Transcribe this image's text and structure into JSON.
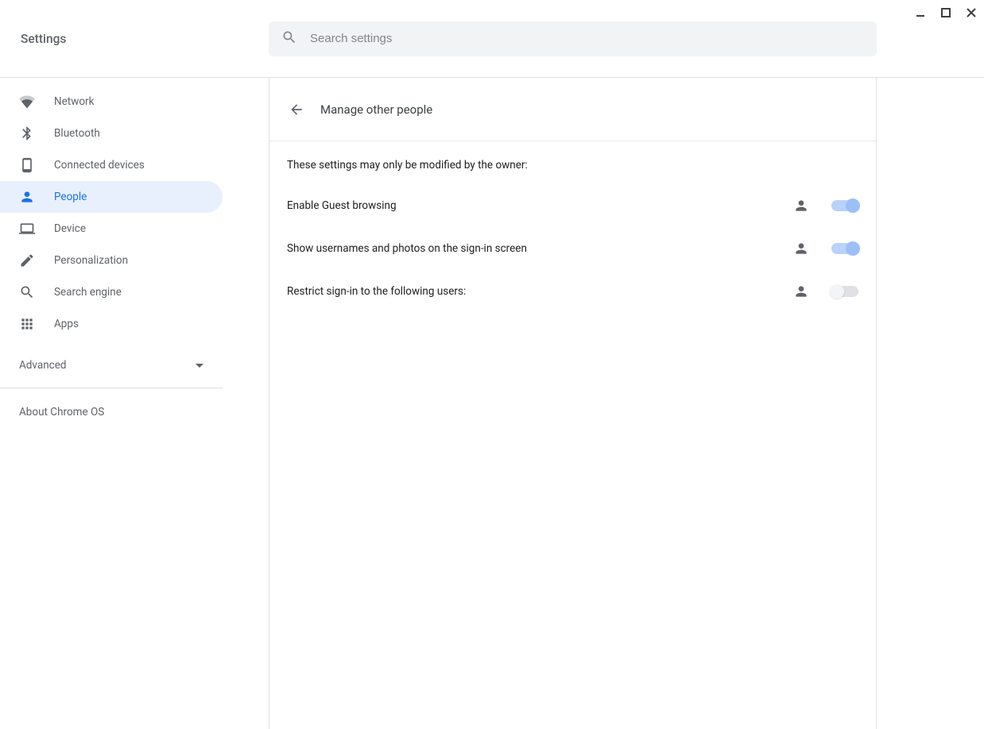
{
  "window": {
    "os": "Chrome OS",
    "app": "Settings"
  },
  "header": {
    "title": "Settings",
    "search_placeholder": "Search settings"
  },
  "sidebar": {
    "items": [
      {
        "id": "network",
        "label": "Network",
        "icon": "wifi-icon",
        "active": false
      },
      {
        "id": "bluetooth",
        "label": "Bluetooth",
        "icon": "bluetooth-icon",
        "active": false
      },
      {
        "id": "connected",
        "label": "Connected devices",
        "icon": "phone-icon",
        "active": false
      },
      {
        "id": "people",
        "label": "People",
        "icon": "person-icon",
        "active": true
      },
      {
        "id": "device",
        "label": "Device",
        "icon": "laptop-icon",
        "active": false
      },
      {
        "id": "personalization",
        "label": "Personalization",
        "icon": "pen-icon",
        "active": false
      },
      {
        "id": "search_engine",
        "label": "Search engine",
        "icon": "search-icon",
        "active": false
      },
      {
        "id": "apps",
        "label": "Apps",
        "icon": "apps-grid-icon",
        "active": false
      }
    ],
    "advanced_label": "Advanced",
    "about_label": "About Chrome OS"
  },
  "main": {
    "subpage_title": "Manage other people",
    "owner_notice": "These settings may only be modified by the owner:",
    "settings": [
      {
        "id": "guest_browsing",
        "label": "Enable Guest browsing",
        "managed_by_owner": true,
        "toggle": {
          "on": true,
          "disabled": true
        }
      },
      {
        "id": "show_usernames",
        "label": "Show usernames and photos on the sign-in screen",
        "managed_by_owner": true,
        "toggle": {
          "on": true,
          "disabled": true
        }
      },
      {
        "id": "restrict_signin",
        "label": "Restrict sign-in to the following users:",
        "managed_by_owner": true,
        "toggle": {
          "on": false,
          "disabled": true
        }
      }
    ]
  }
}
